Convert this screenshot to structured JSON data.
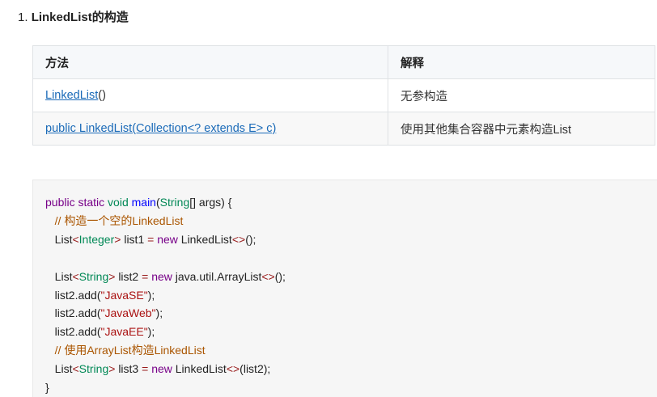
{
  "heading": {
    "number": "1.",
    "title": "LinkedList的构造"
  },
  "table": {
    "headers": [
      "方法",
      "解释"
    ],
    "rows": [
      {
        "method_link": "LinkedList",
        "method_suffix": "()",
        "desc": "无参构造"
      },
      {
        "method_link": "public LinkedList(Collection<? extends E> c)",
        "method_suffix": "",
        "desc": "使用其他集合容器中元素构造List"
      }
    ]
  },
  "code": {
    "lines": [
      [
        [
          "kw",
          "public static "
        ],
        [
          "ty",
          "void "
        ],
        [
          "fn",
          "main"
        ],
        [
          "pl",
          "("
        ],
        [
          "ty",
          "String"
        ],
        [
          "pl",
          "[] args) {"
        ]
      ],
      [
        [
          "pl",
          "   "
        ],
        [
          "cm",
          "// 构造一个空的LinkedList"
        ]
      ],
      [
        [
          "pl",
          "   List"
        ],
        [
          "op",
          "<"
        ],
        [
          "ty",
          "Integer"
        ],
        [
          "op",
          "> "
        ],
        [
          "pl",
          "list1 "
        ],
        [
          "op",
          "= "
        ],
        [
          "kw",
          "new "
        ],
        [
          "pl",
          "LinkedList"
        ],
        [
          "op",
          "<>"
        ],
        [
          "pl",
          "();"
        ]
      ],
      [
        [
          "pl",
          " "
        ]
      ],
      [
        [
          "pl",
          "   List"
        ],
        [
          "op",
          "<"
        ],
        [
          "ty",
          "String"
        ],
        [
          "op",
          "> "
        ],
        [
          "pl",
          "list2 "
        ],
        [
          "op",
          "= "
        ],
        [
          "kw",
          "new "
        ],
        [
          "pl",
          "java.util.ArrayList"
        ],
        [
          "op",
          "<>"
        ],
        [
          "pl",
          "();"
        ]
      ],
      [
        [
          "pl",
          "   list2.add("
        ],
        [
          "st",
          "\"JavaSE\""
        ],
        [
          "pl",
          ");"
        ]
      ],
      [
        [
          "pl",
          "   list2.add("
        ],
        [
          "st",
          "\"JavaWeb\""
        ],
        [
          "pl",
          ");"
        ]
      ],
      [
        [
          "pl",
          "   list2.add("
        ],
        [
          "st",
          "\"JavaEE\""
        ],
        [
          "pl",
          ");"
        ]
      ],
      [
        [
          "pl",
          "   "
        ],
        [
          "cm",
          "// 使用ArrayList构造LinkedList"
        ]
      ],
      [
        [
          "pl",
          "   List"
        ],
        [
          "op",
          "<"
        ],
        [
          "ty",
          "String"
        ],
        [
          "op",
          "> "
        ],
        [
          "pl",
          "list3 "
        ],
        [
          "op",
          "= "
        ],
        [
          "kw",
          "new "
        ],
        [
          "pl",
          "LinkedList"
        ],
        [
          "op",
          "<>"
        ],
        [
          "pl",
          "(list2);"
        ]
      ],
      [
        [
          "pl",
          "}"
        ]
      ]
    ]
  }
}
